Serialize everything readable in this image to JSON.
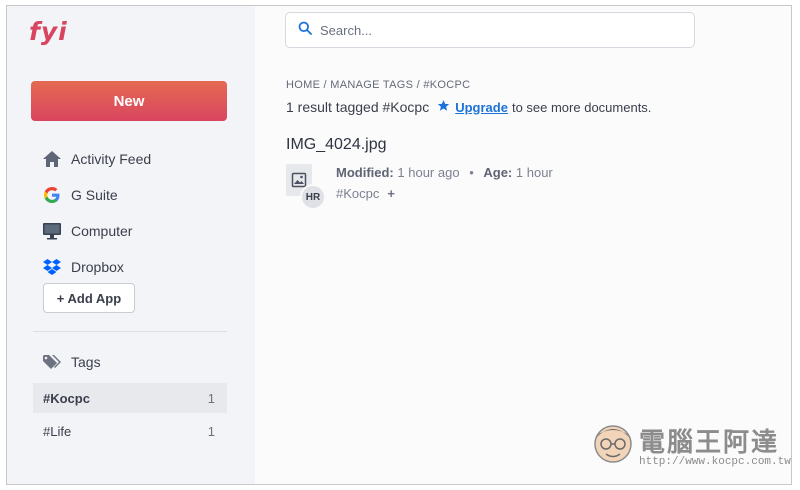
{
  "app": {
    "logo": "fyi"
  },
  "sidebar": {
    "new_label": "New",
    "apps": [
      {
        "label": "Activity Feed",
        "icon": "home-icon"
      },
      {
        "label": "G Suite",
        "icon": "google-icon"
      },
      {
        "label": "Computer",
        "icon": "monitor-icon"
      },
      {
        "label": "Dropbox",
        "icon": "dropbox-icon"
      }
    ],
    "add_app_label": "+ Add App",
    "tags_heading": "Tags",
    "tags": [
      {
        "label": "#Kocpc",
        "count": "1",
        "active": true
      },
      {
        "label": "#Life",
        "count": "1",
        "active": false
      }
    ]
  },
  "search": {
    "placeholder": "Search..."
  },
  "main": {
    "breadcrumb": [
      "HOME",
      "MANAGE TAGS",
      "#KOCPC"
    ],
    "breadcrumb_separator": " / ",
    "result_text": "1 result tagged #Kocpc",
    "upgrade_link": "Upgrade",
    "upsell_suffix": "to see more documents.",
    "file": {
      "name": "IMG_4024.jpg",
      "owner_initials": "HR",
      "modified_label": "Modified:",
      "modified_value": "1 hour ago",
      "age_label": "Age:",
      "age_value": "1 hour",
      "tag": "#Kocpc",
      "add_tag": "+"
    }
  },
  "watermark": {
    "text": "電腦王阿達",
    "url": "http://www.kocpc.com.tw"
  },
  "colors": {
    "brand": "#d9455f",
    "link": "#1b73d8",
    "sidebar_bg": "#f3f4f7"
  }
}
